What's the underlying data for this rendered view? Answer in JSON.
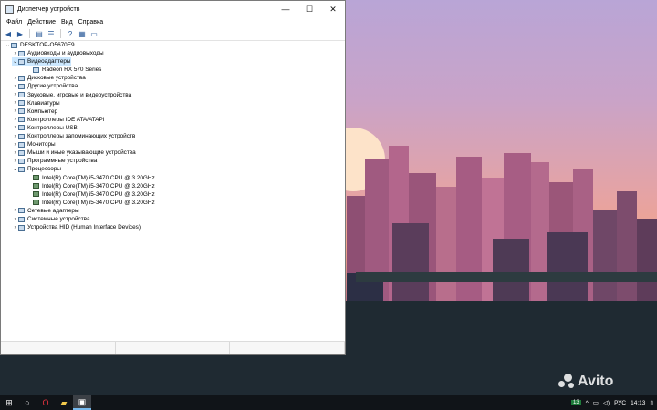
{
  "window": {
    "title": "Диспетчер устройств",
    "controls": {
      "minimize": "—",
      "maximize": "☐",
      "close": "✕"
    }
  },
  "menu": [
    "Файл",
    "Действие",
    "Вид",
    "Справка"
  ],
  "toolbar_icons": [
    "back-arrow-icon",
    "forward-arrow-icon",
    "properties-icon",
    "list-icon",
    "help-icon",
    "view-icon",
    "monitor-icon"
  ],
  "tree": {
    "root": "DESKTOP-O5670E9",
    "items": [
      {
        "label": "Аудиовходы и аудиовыходы",
        "expanded": false,
        "level": 1
      },
      {
        "label": "Видеоадаптеры",
        "expanded": true,
        "level": 1,
        "selected": true
      },
      {
        "label": "Radeon RX 570 Series",
        "expanded": null,
        "level": 2
      },
      {
        "label": "Дисковые устройства",
        "expanded": false,
        "level": 1
      },
      {
        "label": "Другие устройства",
        "expanded": false,
        "level": 1
      },
      {
        "label": "Звуковые, игровые и видеоустройства",
        "expanded": false,
        "level": 1
      },
      {
        "label": "Клавиатуры",
        "expanded": false,
        "level": 1
      },
      {
        "label": "Компьютер",
        "expanded": false,
        "level": 1
      },
      {
        "label": "Контроллеры IDE ATA/ATAPI",
        "expanded": false,
        "level": 1
      },
      {
        "label": "Контроллеры USB",
        "expanded": false,
        "level": 1
      },
      {
        "label": "Контроллеры запоминающих устройств",
        "expanded": false,
        "level": 1
      },
      {
        "label": "Мониторы",
        "expanded": false,
        "level": 1
      },
      {
        "label": "Мыши и иные указывающие устройства",
        "expanded": false,
        "level": 1
      },
      {
        "label": "Программные устройства",
        "expanded": false,
        "level": 1
      },
      {
        "label": "Процессоры",
        "expanded": true,
        "level": 1
      },
      {
        "label": "Intel(R) Core(TM) i5-3470 CPU @ 3.20GHz",
        "expanded": null,
        "level": 2,
        "cpu": true
      },
      {
        "label": "Intel(R) Core(TM) i5-3470 CPU @ 3.20GHz",
        "expanded": null,
        "level": 2,
        "cpu": true
      },
      {
        "label": "Intel(R) Core(TM) i5-3470 CPU @ 3.20GHz",
        "expanded": null,
        "level": 2,
        "cpu": true
      },
      {
        "label": "Intel(R) Core(TM) i5-3470 CPU @ 3.20GHz",
        "expanded": null,
        "level": 2,
        "cpu": true
      },
      {
        "label": "Сетевые адаптеры",
        "expanded": false,
        "level": 1
      },
      {
        "label": "Системные устройства",
        "expanded": false,
        "level": 1
      },
      {
        "label": "Устройства HID (Human Interface Devices)",
        "expanded": false,
        "level": 1
      }
    ]
  },
  "taskbar": {
    "items": [
      "windows-start-icon",
      "search-icon",
      "opera-browser-icon",
      "file-explorer-icon",
      "device-manager-icon"
    ],
    "tray_badge": "13",
    "language": "РУС",
    "time": "14:13"
  },
  "watermark": "Avito"
}
